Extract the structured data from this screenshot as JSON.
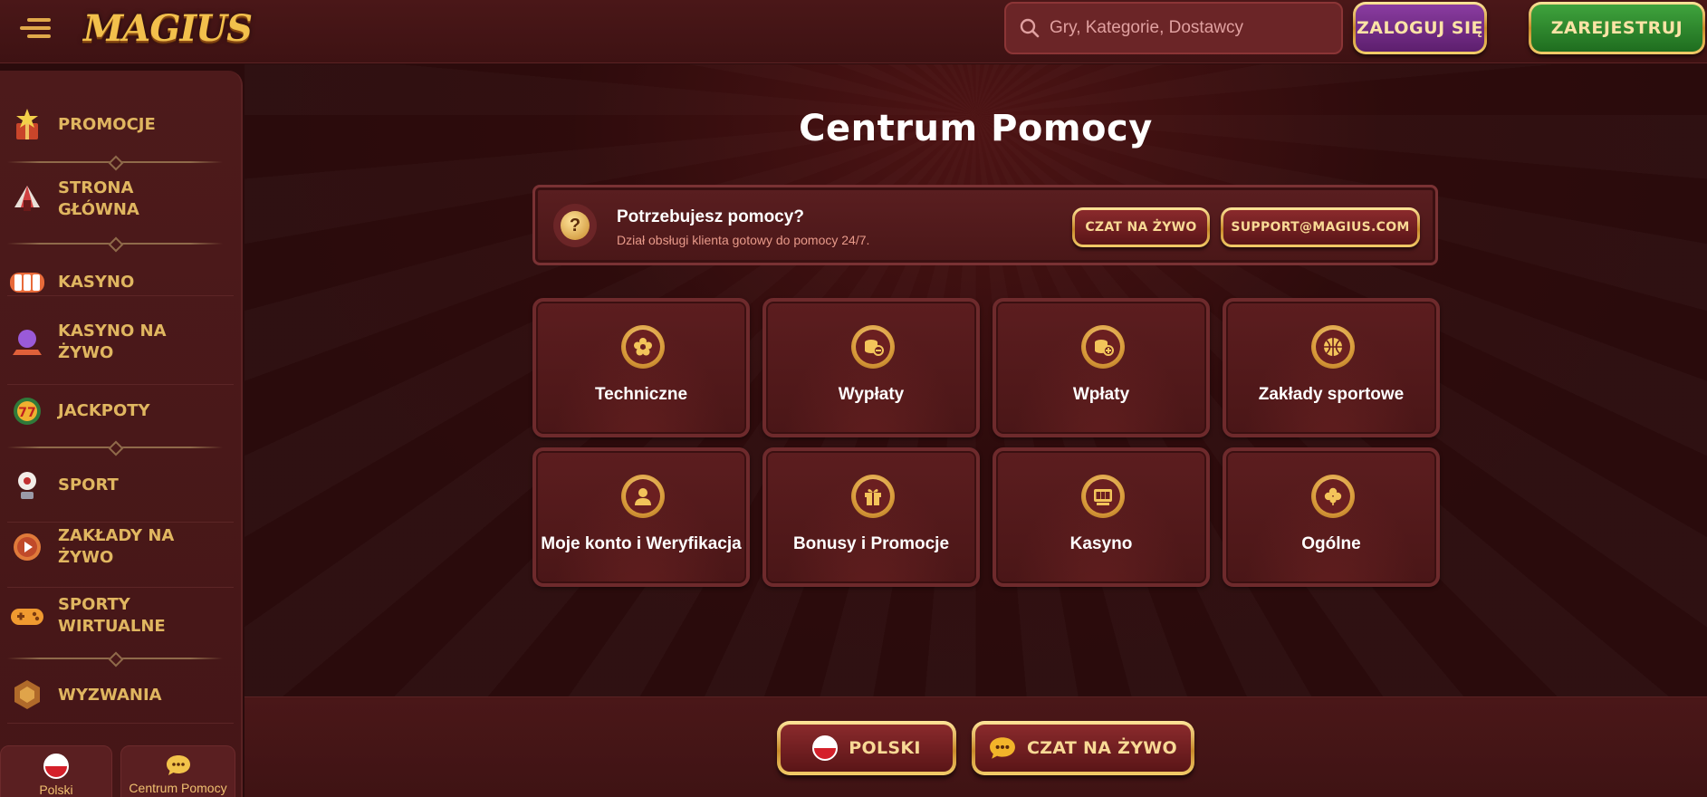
{
  "header": {
    "logo_text": "MAGIUS",
    "search_placeholder": "Gry, Kategorie, Dostawcy",
    "login_label": "ZALOGUJ SIĘ",
    "register_label": "ZAREJESTRUJ"
  },
  "sidebar": {
    "items": [
      {
        "label": "PROMOCJE",
        "icon": "star-gift-icon"
      },
      {
        "label": "STRONA GŁÓWNA",
        "icon": "tent-icon"
      },
      {
        "label": "KASYNO",
        "icon": "slot-reels-icon"
      },
      {
        "label": "KASYNO NA ŻYWO",
        "icon": "crystal-ball-icon"
      },
      {
        "label": "JACKPOTY",
        "icon": "seven-coin-icon"
      },
      {
        "label": "SPORT",
        "icon": "trophy-ball-icon"
      },
      {
        "label": "ZAKŁADY NA ŻYWO",
        "icon": "play-ball-icon"
      },
      {
        "label": "SPORTY WIRTUALNE",
        "icon": "gamepad-icon"
      },
      {
        "label": "WYZWANIA",
        "icon": "medal-icon"
      }
    ],
    "bottom": {
      "language_label": "Polski",
      "help_label": "Centrum Pomocy"
    }
  },
  "main": {
    "title": "Centrum Pomocy",
    "banner": {
      "title": "Potrzebujesz pomocy?",
      "subtitle": "Dział obsługi klienta gotowy do pomocy 24/7.",
      "chat_label": "CZAT NA ŻYWO",
      "email_label": "SUPPORT@MAGIUS.COM"
    },
    "categories": [
      {
        "label": "Techniczne",
        "icon": "gear-flower-icon"
      },
      {
        "label": "Wypłaty",
        "icon": "coins-minus-icon"
      },
      {
        "label": "Wpłaty",
        "icon": "coins-plus-icon"
      },
      {
        "label": "Zakłady sportowe",
        "icon": "basketball-icon"
      },
      {
        "label": "Moje konto i Weryfikacja",
        "icon": "user-icon"
      },
      {
        "label": "Bonusy i Promocje",
        "icon": "gift-icon"
      },
      {
        "label": "Kasyno",
        "icon": "slot-machine-icon"
      },
      {
        "label": "Ogólne",
        "icon": "clover-icon"
      }
    ]
  },
  "footer": {
    "language_label": "POLSKI",
    "chat_label": "CZAT NA ŻYWO"
  },
  "colors": {
    "background": "#2a0b0c",
    "panel": "#4a1718",
    "gold": "#e0b660",
    "login_purple": "#7a2f90",
    "register_green": "#2f8a2e"
  }
}
